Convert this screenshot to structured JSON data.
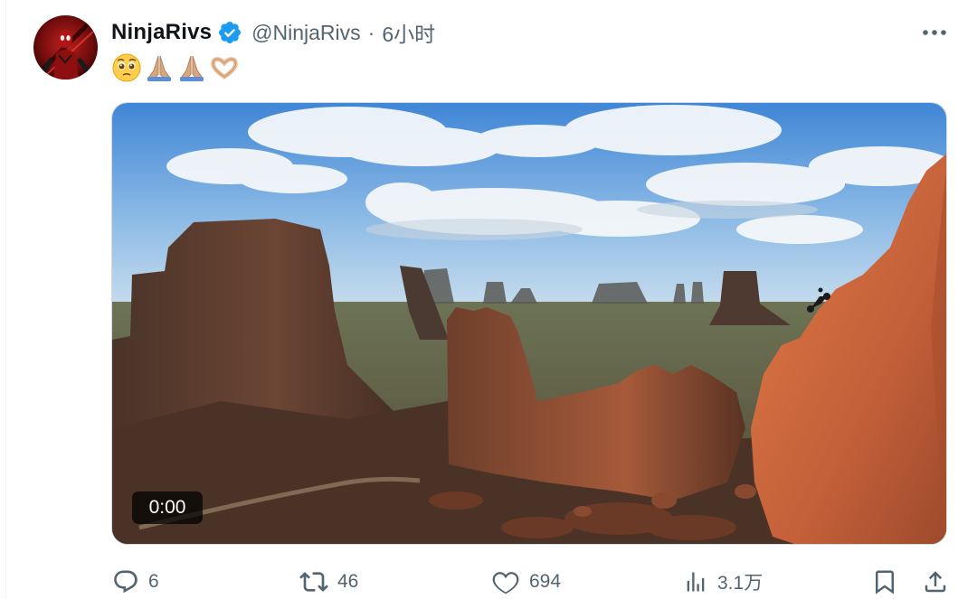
{
  "tweet": {
    "display_name": "NinjaRivs",
    "handle": "@NinjaRivs",
    "separator": "·",
    "time": "6小时",
    "emojis": [
      "pleading-face",
      "folded-hands",
      "folded-hands",
      "heart-hands"
    ],
    "verified": true
  },
  "media": {
    "type": "video",
    "timestamp": "0:00",
    "description_colors": {
      "sky": "#5b9fe0",
      "rock": "#c8673c",
      "desert": "#6e6a4c"
    }
  },
  "actions": {
    "reply_count": "6",
    "repost_count": "46",
    "like_count": "694",
    "views_count": "3.1万"
  },
  "colors": {
    "text_primary": "#0f1419",
    "text_secondary": "#536471",
    "verified_blue": "#1d9bf0"
  }
}
